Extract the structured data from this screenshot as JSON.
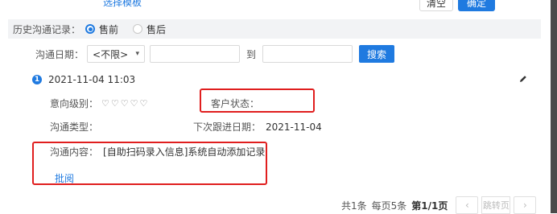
{
  "top": {
    "template_link": "选择模板",
    "clear_label": "清空",
    "ok_label": "确定"
  },
  "history": {
    "label": "历史沟通记录：",
    "options": [
      {
        "label": "售前",
        "checked": true
      },
      {
        "label": "售后",
        "checked": false
      }
    ]
  },
  "filter": {
    "date_label": "沟通日期：",
    "select_value": "<不限>",
    "to_label": "到",
    "search_label": "搜索"
  },
  "record": {
    "index": "1",
    "time": "2021-11-04 11:03",
    "intent_label": "意向级别：",
    "hearts": "♡♡♡♡♡",
    "status_label": "客户状态：",
    "type_label": "沟通类型：",
    "next_date_label": "下次跟进日期：",
    "next_date_value": "2021-11-04",
    "content_label": "沟通内容：",
    "content_value": "[自助扫码录入信息]系统自动添加记录",
    "audit_link": "批阅"
  },
  "pager": {
    "total": "共1条",
    "per_page": "每页5条",
    "page": "第1/1页",
    "prev_icon": "chevron-left-icon",
    "jump_placeholder": "跳转页",
    "next_icon": "chevron-right-icon"
  },
  "colors": {
    "accent": "#1f7ae0",
    "highlight": "#e01e1e"
  }
}
